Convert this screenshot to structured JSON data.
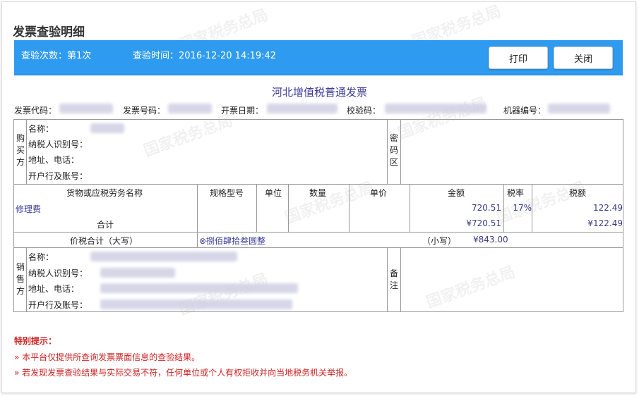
{
  "page": {
    "title": "发票查验明细"
  },
  "topbar": {
    "count_label": "查验次数：第1次",
    "time_label": "查验时间：2016-12-20 14:19:42",
    "print_label": "打印",
    "close_label": "关闭",
    "bg_color": "#2e9bf0"
  },
  "invoice": {
    "title": "河北增值税普通发票",
    "meta": {
      "code_label": "发票代码：",
      "number_label": "发票号码：",
      "date_label": "开票日期：",
      "check_label": "校验码：",
      "machine_label": "机器编号："
    },
    "buyer": {
      "side_label": "购买方",
      "name_label": "名称：",
      "tax_id_label": "纳税人识别号：",
      "address_label": "地址、电话：",
      "bank_label": "开户行及账号：",
      "password_label": "密码区"
    },
    "items": {
      "headers": [
        "货物或应税劳务名称",
        "规格型号",
        "单位",
        "数量",
        "单价",
        "金额",
        "税率",
        "税额"
      ],
      "rows": [
        {
          "name": "修理费",
          "amount": "720.51",
          "rate": "17%",
          "tax": "122.49"
        }
      ],
      "total_label": "合计",
      "total_amount": "¥720.51",
      "total_tax": "¥122.49"
    },
    "grand_total": {
      "label": "价税合计（大写）",
      "upper": "⊗捌佰肆拾叁圆整",
      "lower_label": "（小写）",
      "lower_value": "¥843.00"
    },
    "seller": {
      "side_label": "销售方",
      "name_label": "名称：",
      "tax_id_label": "纳税人识别号：",
      "address_label": "地址、电话：",
      "bank_label": "开户行及账号：",
      "remark_label": "备注"
    }
  },
  "notes": {
    "title": "特别提示：",
    "items": [
      "»  本平台仅提供所查询发票票面信息的查验结果。",
      "»  若发现发票查验结果与实际交易不符，任何单位或个人有权拒收并向当地税务机关举报。"
    ]
  },
  "watermark": {
    "text": "国家税务总局"
  }
}
